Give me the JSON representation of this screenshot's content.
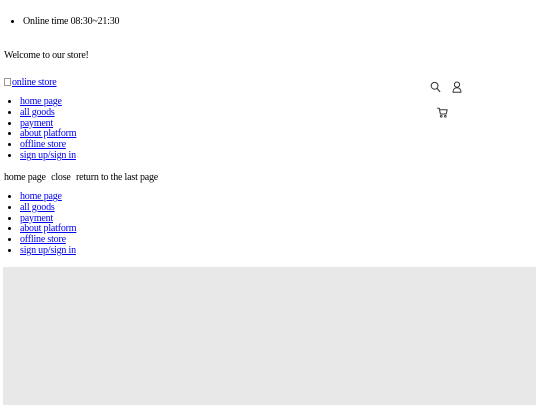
{
  "topbar": {
    "online_time": "Online time 08:30~21:30"
  },
  "welcome_text": "Welcome to our store!",
  "logo": {
    "alt": "online store"
  },
  "header_icons": {
    "search": "search-icon",
    "user": "user-icon",
    "cart": "cart-icon"
  },
  "nav_primary": [
    {
      "label": "home page"
    },
    {
      "label": "all goods"
    },
    {
      "label": "payment"
    },
    {
      "label": "about platform"
    },
    {
      "label": "offline store"
    },
    {
      "label": "sign up/sign in"
    }
  ],
  "mobile_menu": {
    "title": "home page",
    "close_label": "close",
    "back_label": "return to the last page"
  },
  "nav_mobile": [
    {
      "label": "home page"
    },
    {
      "label": "all goods"
    },
    {
      "label": "payment"
    },
    {
      "label": "about platform"
    },
    {
      "label": "offline store"
    },
    {
      "label": "sign up/sign in"
    }
  ],
  "colors": {
    "link": "#0000ee",
    "banner": "#e8e8e8"
  }
}
